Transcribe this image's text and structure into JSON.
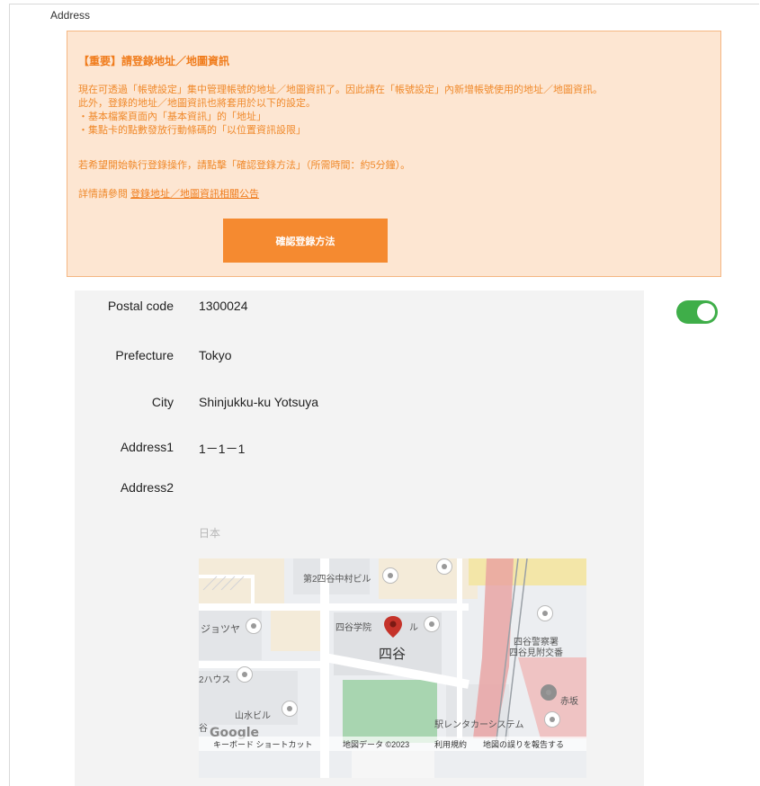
{
  "section": {
    "label": "Address"
  },
  "notice": {
    "title": "【重要】請登錄地址／地圖資訊",
    "lines": [
      "現在可透過「帳號設定」集中管理帳號的地址／地圖資訊了。因此請在「帳號設定」內新增帳號使用的地址／地圖資訊。",
      "此外，登錄的地址／地圖資訊也將套用於以下的設定。",
      "・基本檔案頁面內「基本資訊」的「地址」",
      "・集點卡的點數發放行動條碼的「以位置資訊設限」"
    ],
    "cta_text": "若希望開始執行登錄操作，請點擊「確認登錄方法」（所需時間：約5分鐘）。",
    "link_prefix": "詳情請參閱",
    "link_label": "登錄地址／地圖資訊相關公告",
    "button_label": "確認登錄方法"
  },
  "address": {
    "fields": [
      {
        "label": "Postal code",
        "value": "1300024"
      },
      {
        "label": "Prefecture",
        "value": "Tokyo"
      },
      {
        "label": "City",
        "value": "Shinjukku-ku  Yotsuya"
      },
      {
        "label": "Address1",
        "value": "1－1－1"
      },
      {
        "label": "Address2",
        "value": ""
      }
    ],
    "country": "日本",
    "toggle_on": true
  },
  "map": {
    "labels": {
      "building1": "第2四谷中村ビル",
      "building2": "ジョツヤ",
      "building3": "四谷学院",
      "building3b": "ル",
      "station": "四谷",
      "police1": "四谷警察署",
      "police2": "四谷見附交番",
      "house": "2ハウス",
      "yamamizu": "山水ビル",
      "rental": "駅レンタカーシステム",
      "akasaka": "赤坂",
      "yotsuya_small": "谷"
    },
    "google_logo": "Google",
    "footer": {
      "shortcuts": "キーボード ショートカット",
      "map_data": "地図データ ©2023",
      "terms": "利用規約",
      "report": "地図の誤りを報告する"
    },
    "colors": {
      "pin": "#c5332a",
      "green": "#a8d5b0",
      "rail": "#e57373"
    }
  }
}
